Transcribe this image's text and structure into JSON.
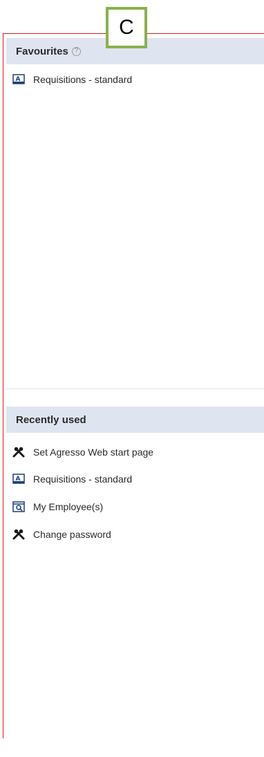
{
  "callout": {
    "label": "C"
  },
  "favourites": {
    "title": "Favourites",
    "help_symbol": "?",
    "items": [
      {
        "label": "Requisitions - standard",
        "icon": "form-icon"
      }
    ]
  },
  "recently_used": {
    "title": "Recently used",
    "items": [
      {
        "label": "Set Agresso Web start page",
        "icon": "tools-icon"
      },
      {
        "label": "Requisitions - standard",
        "icon": "form-icon"
      },
      {
        "label": "My Employee(s)",
        "icon": "inquiry-icon"
      },
      {
        "label": "Change password",
        "icon": "tools-icon"
      }
    ]
  },
  "colors": {
    "header_bg": "#dfe5f0",
    "frame_border": "#d61f1f",
    "callout_border": "#8ab14b"
  }
}
